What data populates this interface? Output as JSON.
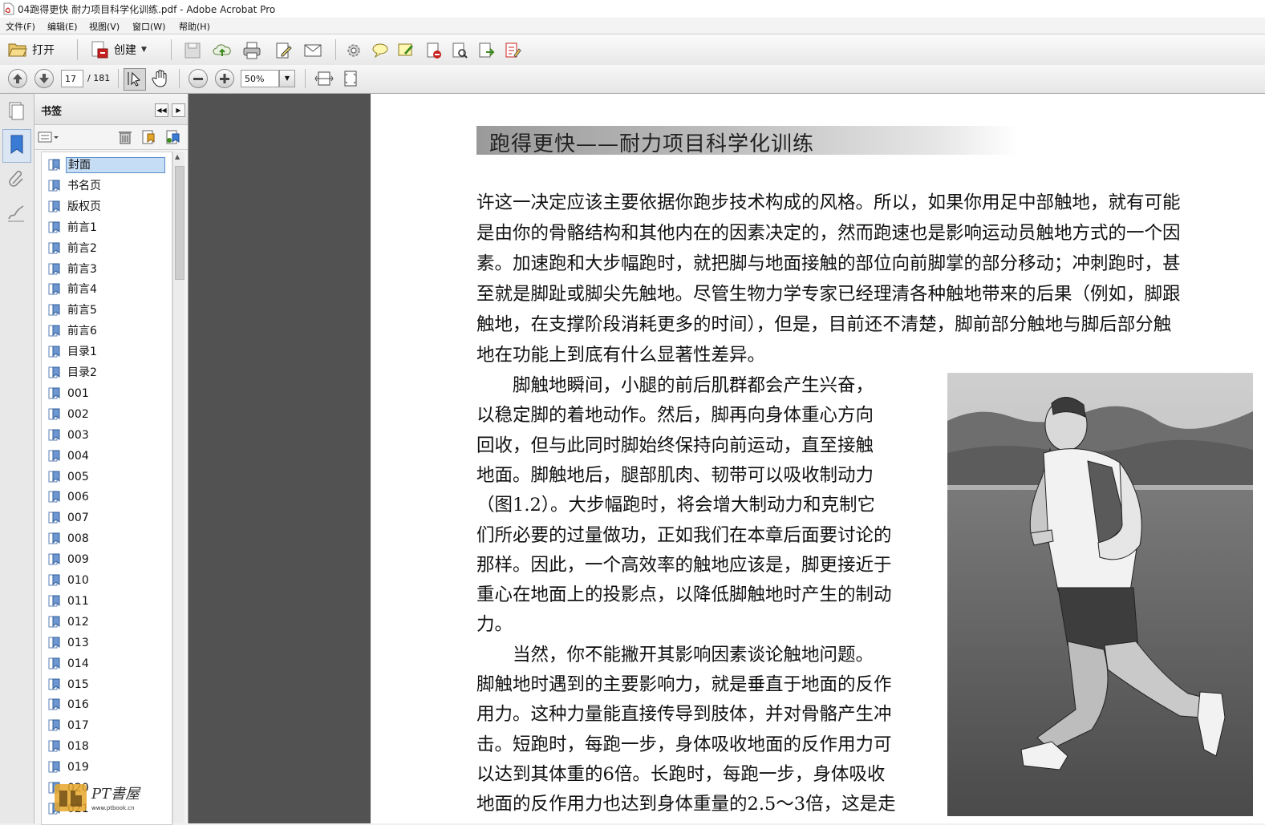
{
  "window": {
    "title": "04跑得更快 耐力项目科学化训练.pdf - Adobe Acrobat Pro"
  },
  "menubar": {
    "items": [
      "文件(F)",
      "编辑(E)",
      "视图(V)",
      "窗口(W)",
      "帮助(H)"
    ]
  },
  "toolbar1": {
    "open_label": "打开",
    "create_label": "创建",
    "icons": [
      "save-icon",
      "cloud-upload-icon",
      "print-icon",
      "edit-icon",
      "email-icon",
      "gear-icon",
      "comment-icon",
      "highlight-icon",
      "secure-icon",
      "sign-icon",
      "export-icon",
      "form-icon"
    ]
  },
  "toolbar2": {
    "page_current": "17",
    "page_total": "/ 181",
    "zoom": "50%"
  },
  "bookmarks": {
    "title": "书签",
    "items": [
      "封面",
      "书名页",
      "版权页",
      "前言1",
      "前言2",
      "前言3",
      "前言4",
      "前言5",
      "前言6",
      "目录1",
      "目录2",
      "001",
      "002",
      "003",
      "004",
      "005",
      "006",
      "007",
      "008",
      "009",
      "010",
      "011",
      "012",
      "013",
      "014",
      "015",
      "016",
      "017",
      "018",
      "019",
      "020",
      "021"
    ],
    "selected_index": 0
  },
  "document": {
    "running_header": "跑得更快——耐力项目科学化训练",
    "full_width_lines": [
      "许这一决定应该主要依据你跑步技术构成的风格。所以，如果你用足中部触地，就有可能",
      "是由你的骨骼结构和其他内在的因素决定的，然而跑速也是影响运动员触地方式的一个因",
      "素。加速跑和大步幅跑时，就把脚与地面接触的部位向前脚掌的部分移动；冲刺跑时，甚",
      "至就是脚趾或脚尖先触地。尽管生物力学专家已经理清各种触地带来的后果（例如，脚跟",
      "触地，在支撑阶段消耗更多的时间），但是，目前还不清楚，脚前部分触地与脚后部分触",
      "地在功能上到底有什么显著性差异。"
    ],
    "column_lines": [
      "　　脚触地瞬间，小腿的前后肌群都会产生兴奋，",
      "以稳定脚的着地动作。然后，脚再向身体重心方向",
      "回收，但与此同时脚始终保持向前运动，直至接触",
      "地面。脚触地后，腿部肌肉、韧带可以吸收制动力",
      "（图1.2）。大步幅跑时，将会增大制动力和克制它",
      "们所必要的过量做功，正如我们在本章后面要讨论的",
      "那样。因此，一个高效率的触地应该是，脚更接近于",
      "重心在地面上的投影点，以降低脚触地时产生的制动",
      "力。",
      "　　当然，你不能撇开其影响因素谈论触地问题。",
      "脚触地时遇到的主要影响力，就是垂直于地面的反作",
      "用力。这种力量能直接传导到肢体，并对骨骼产生冲",
      "击。短跑时，每跑一步，身体吸收地面的反作用力可",
      "以达到其体重的6倍。长跑时，每跑一步，身体吸收",
      "地面的反作用力也达到身体重量的2.5～3倍，这是走"
    ]
  },
  "watermark": {
    "brand": "PT書屋",
    "url": "www.ptbook.cn"
  },
  "colors": {
    "doc_background": "#525252",
    "selection": "#c5ddf5",
    "accent_red": "#c8201e"
  }
}
